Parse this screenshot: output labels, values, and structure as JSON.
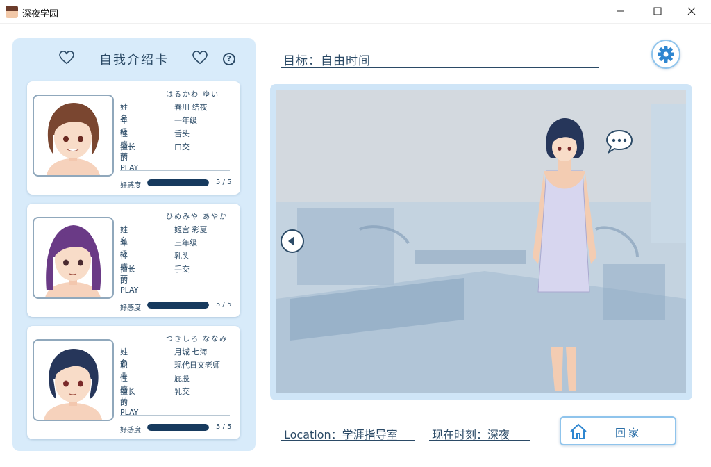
{
  "window": {
    "title": "深夜学园",
    "minimize_glyph": "—",
    "maximize_glyph": "☐",
    "close_glyph": "✕"
  },
  "panel": {
    "title": "自我介绍卡",
    "help_glyph": "?"
  },
  "cards": [
    {
      "furigana": "はるかわ ゆい",
      "rows": [
        {
          "key": "姓名",
          "value": "春川 结夜"
        },
        {
          "key": "年级",
          "value": "一年级"
        },
        {
          "key": "性感带",
          "value": "舌头"
        },
        {
          "key": "擅长的PLAY",
          "value": "口交"
        }
      ],
      "affection_label": "好感度",
      "affection": "5 / 5",
      "affection_fraction": 1.0,
      "hair_color": "#7a4630"
    },
    {
      "furigana": "ひめみや あやか",
      "rows": [
        {
          "key": "姓名",
          "value": "姬宫 彩夏"
        },
        {
          "key": "年级",
          "value": "三年级"
        },
        {
          "key": "性感带",
          "value": "乳头"
        },
        {
          "key": "擅长的PLAY",
          "value": "手交"
        }
      ],
      "affection_label": "好感度",
      "affection": "5 / 5",
      "affection_fraction": 1.0,
      "hair_color": "#6a3a86"
    },
    {
      "furigana": "つきしろ ななみ",
      "rows": [
        {
          "key": "姓名",
          "value": "月城 七海"
        },
        {
          "key": "职业",
          "value": "现代日文老师"
        },
        {
          "key": "性感带",
          "value": "屁股"
        },
        {
          "key": "擅长的PLAY",
          "value": "乳交"
        }
      ],
      "affection_label": "好感度",
      "affection": "5 / 5",
      "affection_fraction": 1.0,
      "hair_color": "#26365a"
    }
  ],
  "goal": "目标：自由时间",
  "location": "Location：学涯指导室",
  "time": "现在时刻：深夜",
  "home_label": "回家",
  "colors": {
    "accent": "#2b4a66",
    "panel_bg": "#d8ebfa",
    "bar_fill": "#173a5e",
    "button_border": "#8fc4ec"
  },
  "icons": [
    "heart-icon",
    "help-icon",
    "gear-icon",
    "left-arrow-icon",
    "speech-bubble-icon",
    "home-icon"
  ]
}
